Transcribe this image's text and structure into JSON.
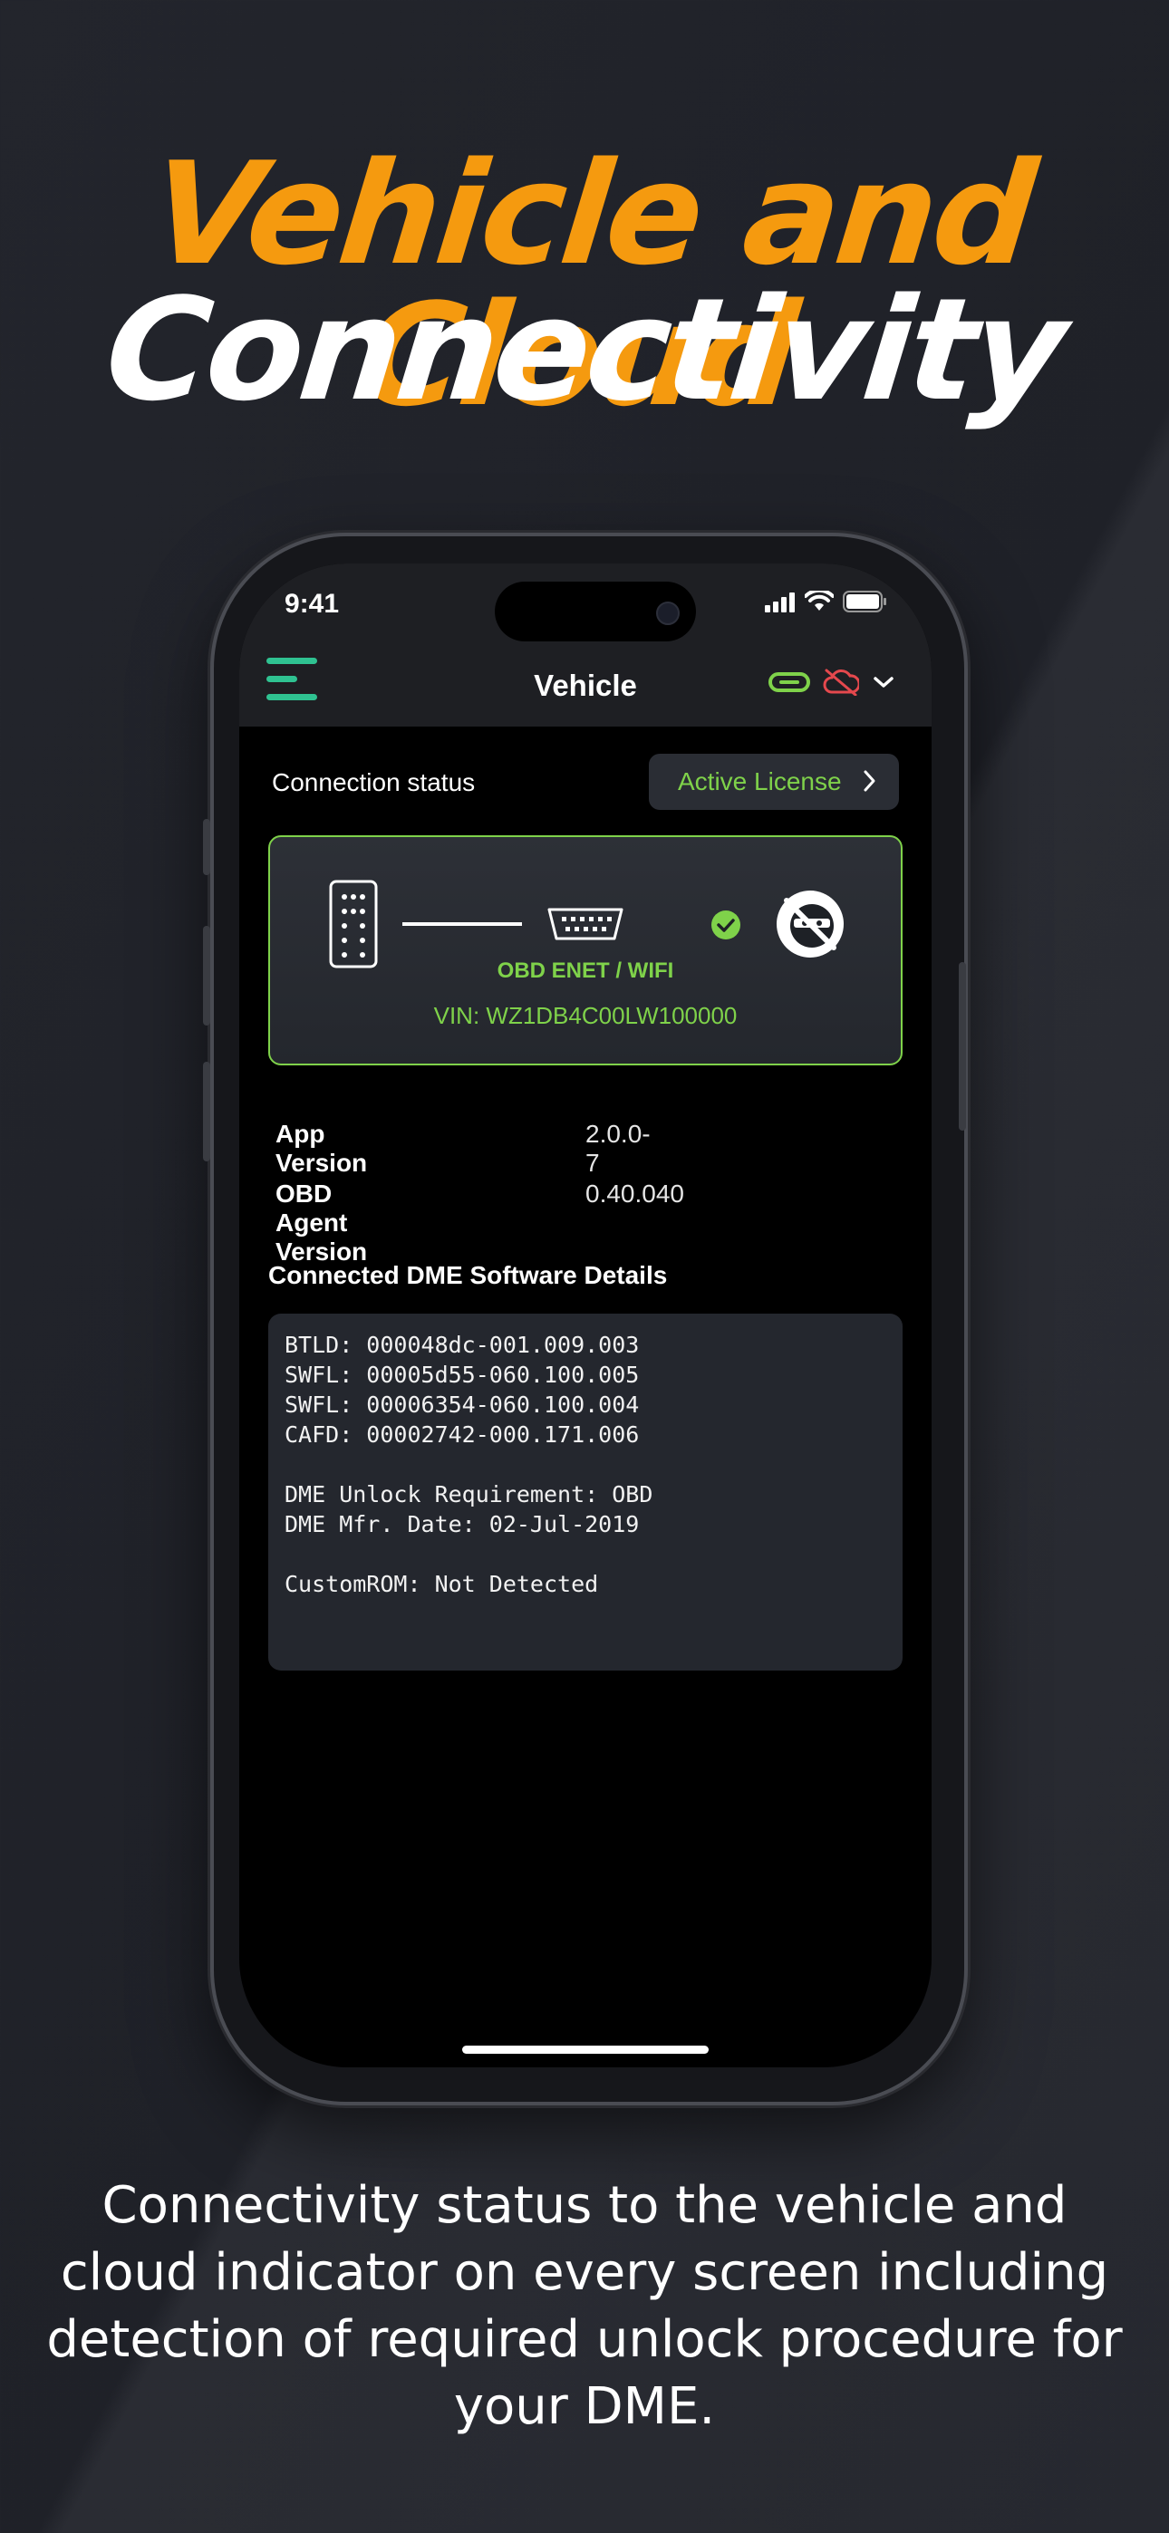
{
  "headline": {
    "line1": "Vehicle and Cloud",
    "line2": "Connectivity"
  },
  "caption": "Connectivity status to the vehicle and cloud indicator on every screen including detection of required unlock procedure for your DME.",
  "status_bar": {
    "time": "9:41"
  },
  "navbar": {
    "title": "Vehicle",
    "icons": [
      "menu-icon",
      "link-icon",
      "cloud-off-icon",
      "chevron-down-icon"
    ]
  },
  "connection": {
    "label": "Connection status",
    "license_button": "Active License",
    "adapter_label": "OBD ENET / WIFI",
    "vin": "VIN: WZ1DB4C00LW100000"
  },
  "versions": [
    {
      "key": "App Version",
      "value": "2.0.0-7"
    },
    {
      "key": "OBD Agent Version",
      "value": "0.40.040"
    }
  ],
  "dme": {
    "title": "Connected DME Software Details",
    "details": "BTLD: 000048dc-001.009.003\nSWFL: 00005d55-060.100.005\nSWFL: 00006354-060.100.004\nCAFD: 00002742-000.171.006\n\nDME Unlock Requirement: OBD\nDME Mfr. Date: 02-Jul-2019\n\nCustomROM: Not Detected"
  },
  "colors": {
    "accent_orange": "#f59a0f",
    "accent_green": "#7fd24a",
    "menu_teal": "#2fc291",
    "cloud_red": "#e5484d"
  }
}
